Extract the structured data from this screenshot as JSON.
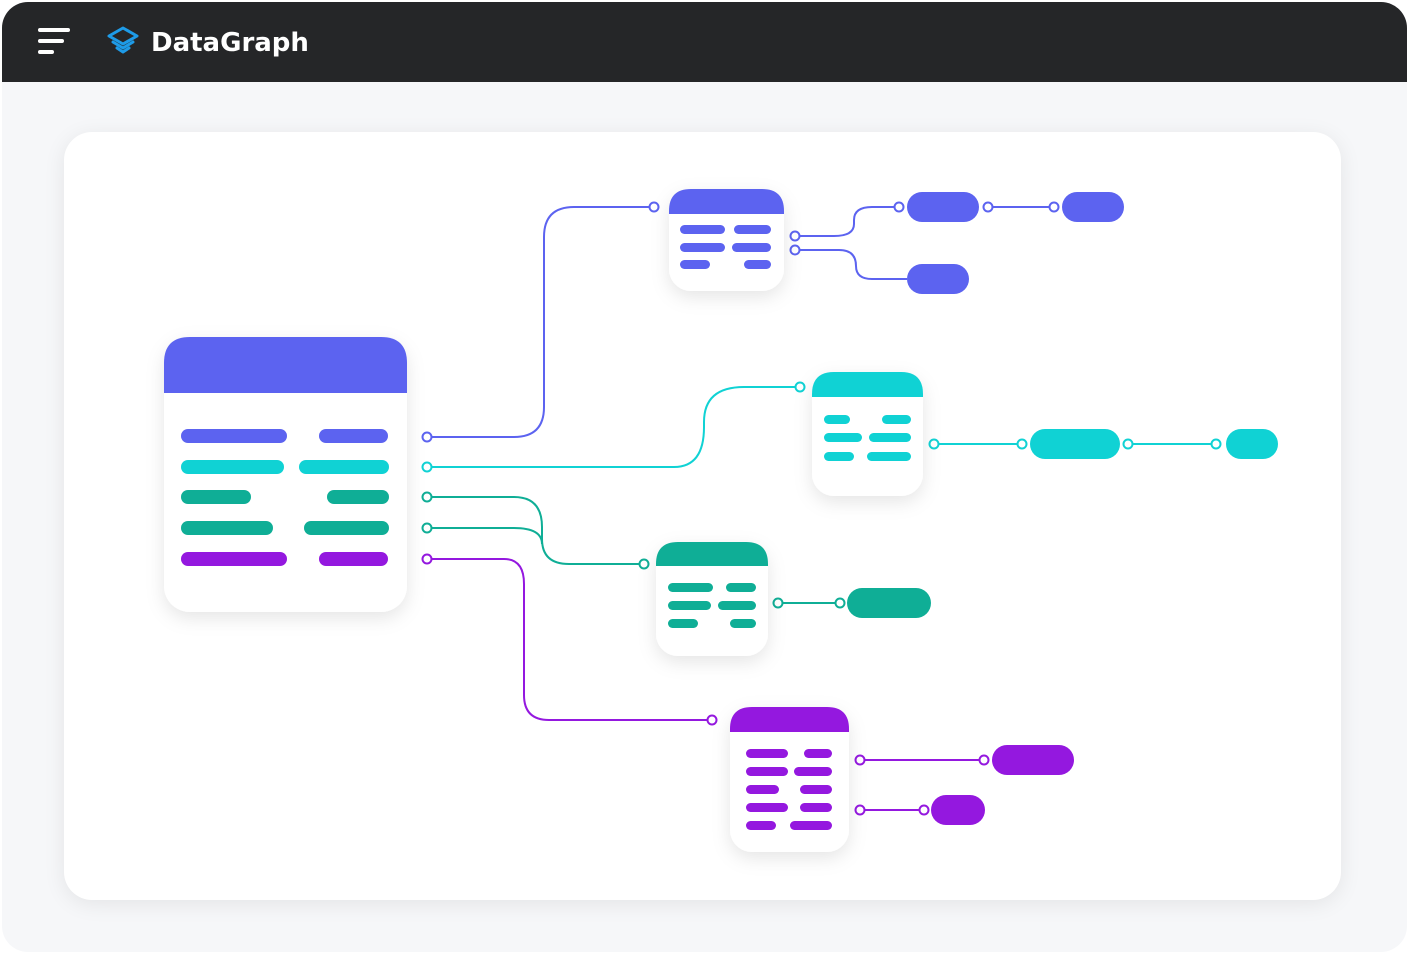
{
  "app": {
    "title": "DataGraph"
  },
  "icons": {
    "menu": "hamburger-menu-icon",
    "logo": "stacked-layers-logo-icon"
  },
  "colors": {
    "topbar": "#252628",
    "indigo": "#5c63f0",
    "cyan": "#10d2d4",
    "teal": "#0fae96",
    "purple": "#9418df"
  }
}
